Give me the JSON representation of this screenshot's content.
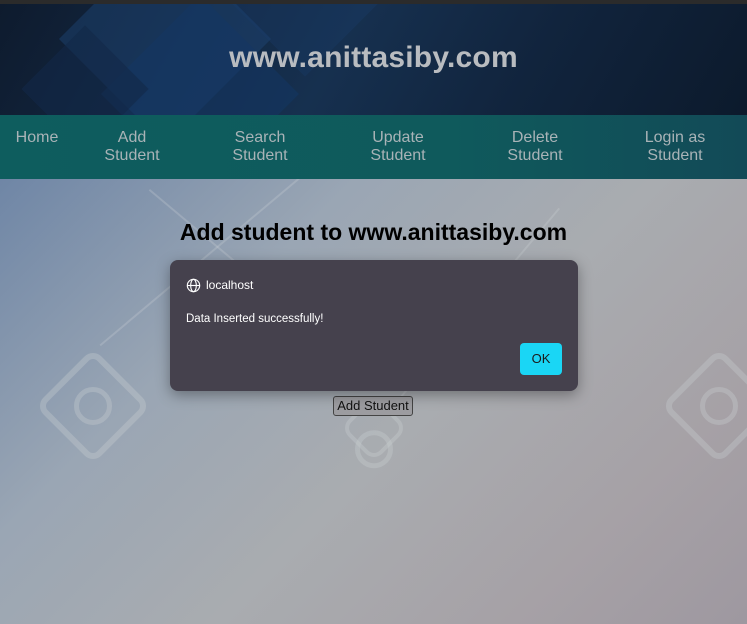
{
  "header": {
    "site_title": "www.anittasiby.com"
  },
  "nav": {
    "items": [
      {
        "line1": "Home",
        "line2": ""
      },
      {
        "line1": "Add",
        "line2": "Student"
      },
      {
        "line1": "Search",
        "line2": "Student"
      },
      {
        "line1": "Update",
        "line2": "Student"
      },
      {
        "line1": "Delete",
        "line2": "Student"
      },
      {
        "line1": "Login as",
        "line2": "Student"
      }
    ]
  },
  "main": {
    "heading": "Add student to www.anittasiby.com",
    "add_button_label": "Add Student"
  },
  "dialog": {
    "origin": "localhost",
    "message": "Data Inserted successfully!",
    "ok_label": "OK"
  },
  "colors": {
    "nav_bg": "#0e5d5e",
    "header_bg": "#16304f",
    "dialog_bg": "#45414d",
    "ok_button": "#1ad6f5"
  },
  "icons": {
    "dialog_origin": "globe-icon"
  }
}
